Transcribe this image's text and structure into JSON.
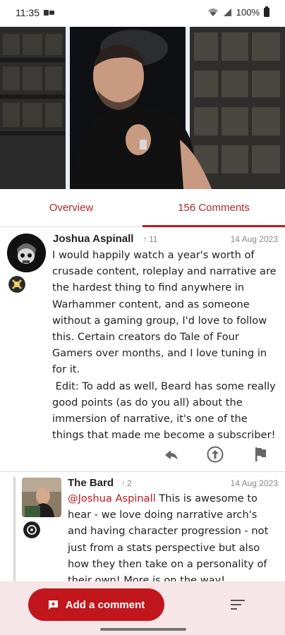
{
  "status_bar": {
    "time": "11:35",
    "battery": "100%"
  },
  "video": {
    "icon": "video-player"
  },
  "tabs": [
    {
      "label": "Overview",
      "active": false
    },
    {
      "label": "156 Comments",
      "active": true
    }
  ],
  "comments": [
    {
      "author": "Joshua Aspinall",
      "votes": "11",
      "date": "14 Aug 2023",
      "body": "I would happily watch a year's worth of crusade content, roleplay and narrative are the hardest thing to find anywhere in Warhammer content, and as someone without a gaming group, I'd love to follow this. Certain creators do Tale of Four Gamers over months, and I love tuning in for it.\n Edit: To add as well, Beard has some really good points (as do you all) about the immersion of narrative, it's one of the things that made me become a subscriber!"
    },
    {
      "author": "The Bard",
      "votes": "2",
      "date": "14 Aug 2023",
      "mention": "@Joshua Aspinall",
      "body": " This is awesome to hear - we love doing narrative arch's and having character progression - not just from a stats perspective but also how they then take on a personality of their own! More is on the way!"
    }
  ],
  "bottom_bar": {
    "add_comment_label": "Add a comment"
  },
  "colors": {
    "accent": "#c0161c",
    "bottom_bar_bg": "#f7e6e7"
  }
}
